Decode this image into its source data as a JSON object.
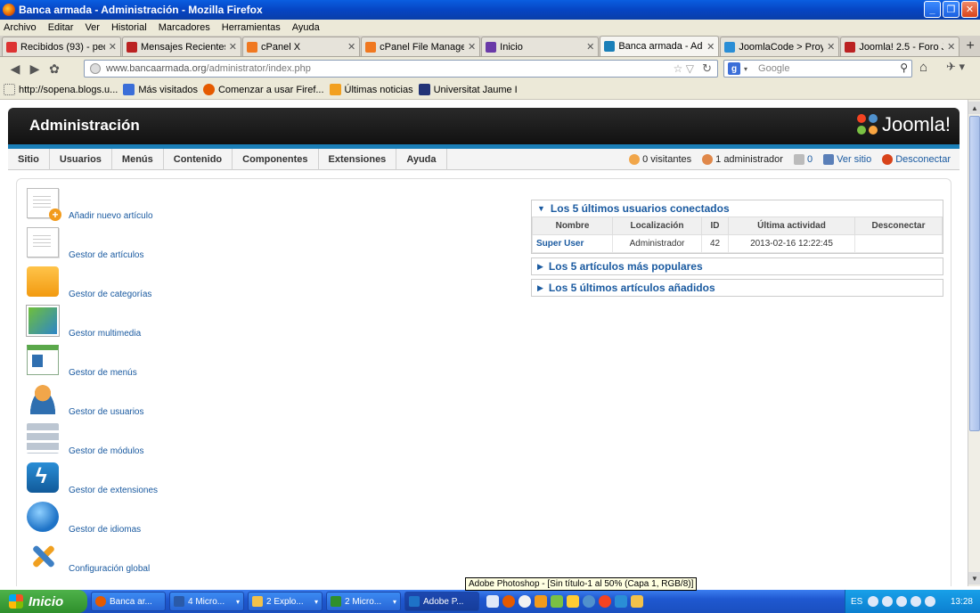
{
  "window": {
    "title": "Banca armada - Administración - Mozilla Firefox"
  },
  "menubar": [
    "Archivo",
    "Editar",
    "Ver",
    "Historial",
    "Marcadores",
    "Herramientas",
    "Ayuda"
  ],
  "tabs": [
    {
      "label": "Recibidos (93) - pedr...",
      "color": "#d33"
    },
    {
      "label": "Mensajes Recientes -...",
      "color": "#b22"
    },
    {
      "label": "cPanel X",
      "color": "#f07820"
    },
    {
      "label": "cPanel File Manager v3",
      "color": "#f07820"
    },
    {
      "label": "Inicio",
      "color": "#6a3aa8"
    },
    {
      "label": "Banca armada - Admi...",
      "color": "#1a7fb8",
      "active": true
    },
    {
      "label": "JoomlaCode > Proye...",
      "color": "#2a8ed6"
    },
    {
      "label": "Joomla! 2.5 - Foro Jo...",
      "color": "#b22"
    }
  ],
  "address": {
    "host": "www.bancaarmada.org",
    "path": "/administrator/index.php"
  },
  "search": {
    "engine": "g",
    "placeholder": "Google"
  },
  "bookmarks": [
    {
      "label": "http://sopena.blogs.u...",
      "color": "#fff"
    },
    {
      "label": "Más visitados",
      "color": "#3b6ed8"
    },
    {
      "label": "Comenzar a usar Firef...",
      "color": "#e55a00"
    },
    {
      "label": "Últimas noticias",
      "color": "#f2a020"
    },
    {
      "label": "Universitat Jaume I",
      "color": "#223377"
    }
  ],
  "joomla": {
    "header_title": "Administración",
    "logo_text": "Joomla!",
    "menu": [
      "Sitio",
      "Usuarios",
      "Menús",
      "Contenido",
      "Componentes",
      "Extensiones",
      "Ayuda"
    ],
    "status": {
      "visitors": "0 visitantes",
      "admins": "1 administrador",
      "messages": "0",
      "view_site": "Ver sitio",
      "logout": "Desconectar"
    }
  },
  "quick_icons": [
    {
      "label": "Añadir nuevo artículo",
      "icon": "add-article-icon"
    },
    {
      "label": "Gestor de artículos",
      "icon": "article-manager-icon"
    },
    {
      "label": "Gestor de categorías",
      "icon": "folder-icon"
    },
    {
      "label": "Gestor multimedia",
      "icon": "media-icon"
    },
    {
      "label": "Gestor de menús",
      "icon": "menu-manager-icon"
    },
    {
      "label": "Gestor de usuarios",
      "icon": "users-icon"
    },
    {
      "label": "Gestor de módulos",
      "icon": "modules-icon"
    },
    {
      "label": "Gestor de extensiones",
      "icon": "extensions-icon"
    },
    {
      "label": "Gestor de idiomas",
      "icon": "globe-icon"
    },
    {
      "label": "Configuración global",
      "icon": "tools-icon"
    }
  ],
  "panels": {
    "logged": {
      "title": "Los 5 últimos usuarios conectados",
      "columns": [
        "Nombre",
        "Localización",
        "ID",
        "Última actividad",
        "Desconectar"
      ],
      "rows": [
        [
          "Super User",
          "Administrador",
          "42",
          "2013-02-16 12:22:45",
          ""
        ]
      ]
    },
    "popular": {
      "title": "Los 5 artículos más populares"
    },
    "latest": {
      "title": "Los 5 últimos artículos añadidos"
    }
  },
  "tooltip": "Adobe Photoshop - [Sin título-1 al 50% (Capa 1, RGB/8)]",
  "taskbar": {
    "start": "Inicio",
    "items": [
      {
        "label": "Banca ar..."
      },
      {
        "label": "4 Micro..."
      },
      {
        "label": "2 Explo..."
      },
      {
        "label": "2 Micro..."
      },
      {
        "label": "Adobe P..."
      }
    ],
    "lang": "ES",
    "clock": "13:28"
  }
}
